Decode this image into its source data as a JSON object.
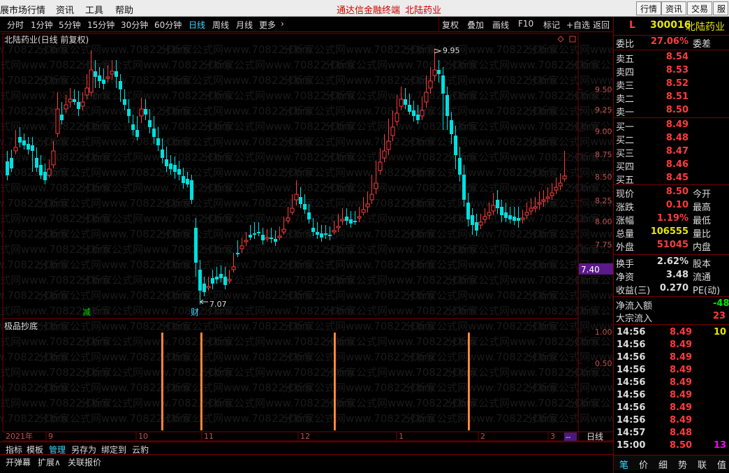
{
  "menu": {
    "items": [
      "展市场行情",
      "资讯",
      "工具",
      "帮助"
    ],
    "center_terminal": "通达信金融终端",
    "center_stock": "北陆药业",
    "right_buttons": [
      "行情",
      "资讯",
      "交易",
      "服"
    ]
  },
  "toolbar": {
    "periods": [
      "分时",
      "1分钟",
      "5分钟",
      "15分钟",
      "30分钟",
      "60分钟",
      "日线",
      "周线",
      "月线",
      "更多"
    ],
    "active_period": "日线",
    "more_arrow": "›",
    "buttons": [
      "复权",
      "叠加",
      "画线",
      "F10",
      "标记",
      "+自选",
      "返回"
    ]
  },
  "chart": {
    "title": "北陆药业(日线 前复权)",
    "high_label": "9.95",
    "low_label": "7.07",
    "marker_left": "减",
    "marker_right": "财",
    "price_axis": [
      "9.50",
      "9.25",
      "9.00",
      "8.75",
      "8.50",
      "8.25",
      "8.00",
      "7.75"
    ],
    "current_price_tag": "7.40",
    "indicator_title": "极品抄底",
    "indicator_axis": [
      "1.00",
      "0.50"
    ],
    "date_labels": [
      "2021年",
      "9",
      "10",
      "11",
      "12",
      "1",
      "2",
      "3"
    ],
    "period_box": "日线",
    "zoom_controls": [
      "+",
      "-",
      "0"
    ],
    "dashes": "--",
    "watermark": "分析家公式网www.70822.Com"
  },
  "tabs": {
    "row1": [
      "指标",
      "模板",
      "管理",
      "另存为",
      "绑定到",
      "云豹"
    ],
    "row1_active": "管理",
    "row2": [
      "开弹幕",
      "扩展∧",
      "关联报价"
    ]
  },
  "quote": {
    "code_prefix": "L",
    "code": "300016",
    "name": "北陆药业",
    "weibi": {
      "label": "委比",
      "value": "27.06%",
      "right": "委差"
    },
    "asks": [
      {
        "label": "卖五",
        "price": "8.54"
      },
      {
        "label": "卖四",
        "price": "8.53"
      },
      {
        "label": "卖三",
        "price": "8.52"
      },
      {
        "label": "卖二",
        "price": "8.51"
      },
      {
        "label": "卖一",
        "price": "8.50"
      }
    ],
    "bids": [
      {
        "label": "买一",
        "price": "8.49"
      },
      {
        "label": "买二",
        "price": "8.48"
      },
      {
        "label": "买三",
        "price": "8.47"
      },
      {
        "label": "买四",
        "price": "8.46"
      },
      {
        "label": "买五",
        "price": "8.45"
      }
    ],
    "stats": [
      {
        "label": "现价",
        "value": "8.50",
        "right": "今开",
        "cls": "red"
      },
      {
        "label": "涨跌",
        "value": "0.10",
        "right": "最高",
        "cls": "red"
      },
      {
        "label": "涨幅",
        "value": "1.19%",
        "right": "最低",
        "cls": "red"
      },
      {
        "label": "总量",
        "value": "106555",
        "right": "量比",
        "cls": "yellow"
      },
      {
        "label": "外盘",
        "value": "51045",
        "right": "内盘",
        "cls": "red"
      }
    ],
    "stats2": [
      {
        "label": "换手",
        "value": "2.62%",
        "right": "股本",
        "cls": "w"
      },
      {
        "label": "净资",
        "value": "3.48",
        "right": "流通",
        "cls": "w"
      },
      {
        "label": "收益(三)",
        "value": "0.270",
        "right": "PE(动)",
        "cls": "w"
      }
    ],
    "flows": [
      {
        "label": "净流入额",
        "value": "-48",
        "cls": "green"
      },
      {
        "label": "大宗流入",
        "value": "23",
        "cls": "red"
      }
    ],
    "ticks": [
      {
        "time": "14:56",
        "price": "8.49",
        "vol": "10",
        "cls": "yellow"
      },
      {
        "time": "14:56",
        "price": "8.49",
        "vol": "",
        "cls": "yellow"
      },
      {
        "time": "14:56",
        "price": "8.49",
        "vol": "",
        "cls": "yellow"
      },
      {
        "time": "14:56",
        "price": "8.49",
        "vol": "",
        "cls": "yellow"
      },
      {
        "time": "14:56",
        "price": "8.49",
        "vol": "",
        "cls": "yellow"
      },
      {
        "time": "14:56",
        "price": "8.49",
        "vol": "",
        "cls": "yellow"
      },
      {
        "time": "14:56",
        "price": "8.49",
        "vol": "",
        "cls": "yellow"
      },
      {
        "time": "14:56",
        "price": "8.49",
        "vol": "",
        "cls": "yellow"
      },
      {
        "time": "14:57",
        "price": "8.48",
        "vol": "",
        "cls": "yellow"
      },
      {
        "time": "15:00",
        "price": "8.50",
        "vol": "13",
        "cls": "magenta"
      }
    ],
    "bottom_tabs": [
      "笔",
      "价",
      "细",
      "势",
      "联",
      "值"
    ]
  }
}
